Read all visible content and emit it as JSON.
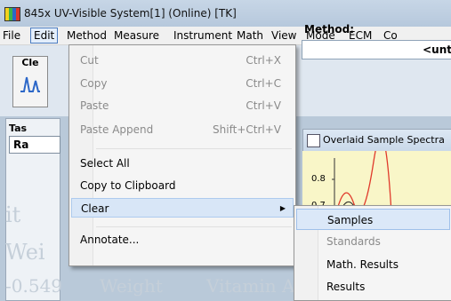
{
  "window": {
    "title": "845x UV-Visible System[1] (Online) [TK]"
  },
  "menubar": {
    "items": [
      {
        "label": "File"
      },
      {
        "label": "Edit"
      },
      {
        "label": "Method"
      },
      {
        "label": "Measure"
      },
      {
        "label": "Instrument"
      },
      {
        "label": "Math"
      },
      {
        "label": "View"
      },
      {
        "label": "Mode"
      },
      {
        "label": "ECM"
      },
      {
        "label": "Co"
      }
    ]
  },
  "toolbar": {
    "clear_button_label": "Cle"
  },
  "method": {
    "label": "Method:",
    "value": "<unt"
  },
  "task": {
    "label": "Tas",
    "combo_value": "Ra"
  },
  "spectra": {
    "title": "Overlaid Sample Spectra",
    "y_ticks": [
      "0.8",
      "0.7"
    ]
  },
  "background_text": [
    "Wei",
    "-0.549",
    "Weight",
    "Vitamin A-0"
  ],
  "edit_menu": {
    "items": [
      {
        "label": "Cut",
        "shortcut": "Ctrl+X",
        "disabled": true
      },
      {
        "label": "Copy",
        "shortcut": "Ctrl+C",
        "disabled": true
      },
      {
        "label": "Paste",
        "shortcut": "Ctrl+V",
        "disabled": true
      },
      {
        "label": "Paste Append",
        "shortcut": "Shift+Ctrl+V",
        "disabled": true
      },
      {
        "label": "Select All",
        "shortcut": "",
        "disabled": false
      },
      {
        "label": "Copy to Clipboard",
        "shortcut": "",
        "disabled": false
      },
      {
        "label": "Clear",
        "shortcut": "",
        "disabled": false,
        "submenu": true,
        "highlighted": true
      },
      {
        "label": "Annotate...",
        "shortcut": "",
        "disabled": false
      }
    ]
  },
  "clear_submenu": {
    "items": [
      {
        "label": "Samples",
        "disabled": false,
        "highlighted": true
      },
      {
        "label": "Standards",
        "disabled": true
      },
      {
        "label": "Math. Results",
        "disabled": false
      },
      {
        "label": "Results",
        "disabled": false
      }
    ]
  },
  "colors": {
    "accent": "#4b7cc0",
    "highlight": "#dbe8f8",
    "plot_bg": "#f9f6c8",
    "plot_line": "#e03a2c"
  }
}
